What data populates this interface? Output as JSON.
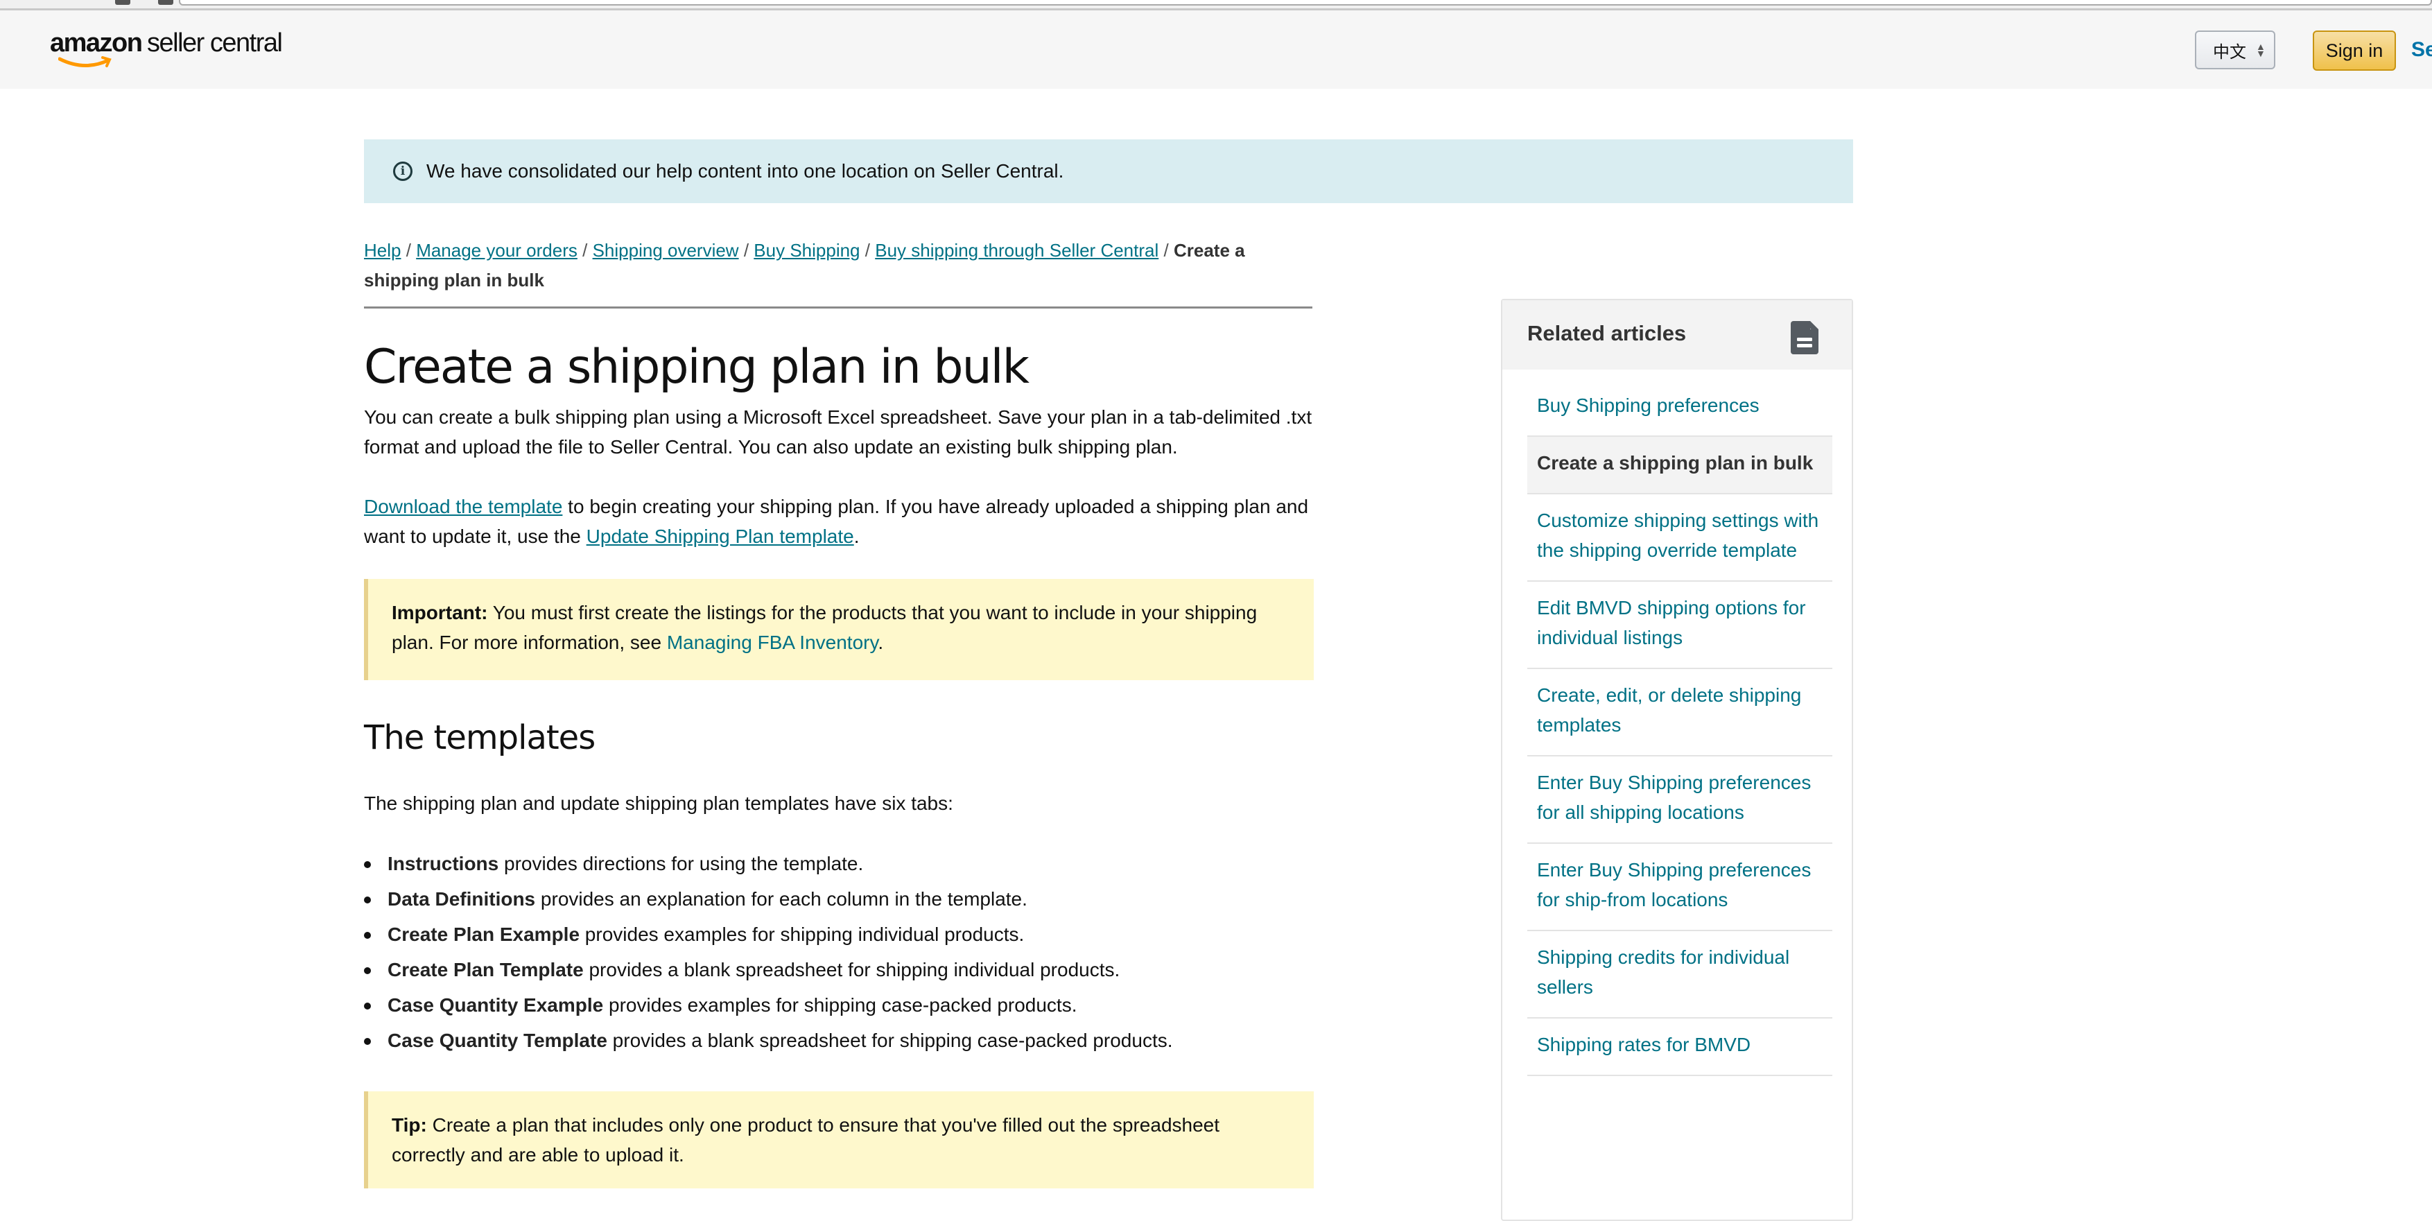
{
  "header": {
    "logo_brand": "amazon",
    "logo_product": "seller central",
    "language_select_value": "中文",
    "sign_in_label": "Sign in",
    "sign_up_label_partial": "Se"
  },
  "banner": {
    "icon": "info-icon",
    "text": "We have consolidated our help content into one location on Seller Central."
  },
  "breadcrumb": {
    "items": [
      "Help",
      "Manage your orders",
      "Shipping overview",
      "Buy Shipping",
      "Buy shipping through Seller Central"
    ],
    "separator": "/",
    "current": "Create a shipping plan in bulk"
  },
  "article": {
    "title": "Create a shipping plan in bulk",
    "intro": "You can create a bulk shipping plan using a Microsoft Excel spreadsheet. Save your plan in a tab-delimited .txt format and upload the file to Seller Central. You can also update an existing bulk shipping plan.",
    "download_link": "Download the template",
    "download_text_1": " to begin creating your shipping plan. If you have already uploaded a shipping plan and want to update it, use the ",
    "update_link": "Update Shipping Plan template",
    "download_text_2": ".",
    "important": {
      "label": "Important:",
      "text": " You must first create the listings for the products that you want to include in your shipping plan. For more information, see ",
      "link": "Managing FBA Inventory",
      "end": "."
    },
    "templates_heading": "The templates",
    "templates_intro": "The shipping plan and update shipping plan templates have six tabs:",
    "tabs": [
      {
        "name": "Instructions",
        "desc": " provides directions for using the template."
      },
      {
        "name": "Data Definitions",
        "desc": " provides an explanation for each column in the template."
      },
      {
        "name": "Create Plan Example",
        "desc": " provides examples for shipping individual products."
      },
      {
        "name": "Create Plan Template",
        "desc": " provides a blank spreadsheet for shipping individual products."
      },
      {
        "name": "Case Quantity Example",
        "desc": " provides examples for shipping case-packed products."
      },
      {
        "name": "Case Quantity Template",
        "desc": " provides a blank spreadsheet for shipping case-packed products."
      }
    ],
    "tip": {
      "label": "Tip:",
      "text": " Create a plan that includes only one product to ensure that you've filled out the spreadsheet correctly and are able to upload it."
    }
  },
  "sidebar": {
    "title": "Related articles",
    "icon": "document-icon",
    "items": [
      {
        "label": "Buy Shipping preferences",
        "active": false
      },
      {
        "label": "Create a shipping plan in bulk",
        "active": true
      },
      {
        "label": "Customize shipping settings with the shipping override template",
        "active": false
      },
      {
        "label": "Edit BMVD shipping options for individual listings",
        "active": false
      },
      {
        "label": "Create, edit, or delete shipping templates",
        "active": false
      },
      {
        "label": "Enter Buy Shipping preferences for all shipping locations",
        "active": false
      },
      {
        "label": "Enter Buy Shipping preferences for ship-from locations",
        "active": false
      },
      {
        "label": "Shipping credits for individual sellers",
        "active": false
      },
      {
        "label": "Shipping rates for BMVD",
        "active": false
      }
    ]
  },
  "colors": {
    "link": "#007185",
    "banner_bg": "#d9edf1",
    "note_bg": "#fef8cc",
    "note_border": "#e7d18d",
    "signin_bg": "#f0c14b",
    "logo_smile": "#ff9900"
  }
}
